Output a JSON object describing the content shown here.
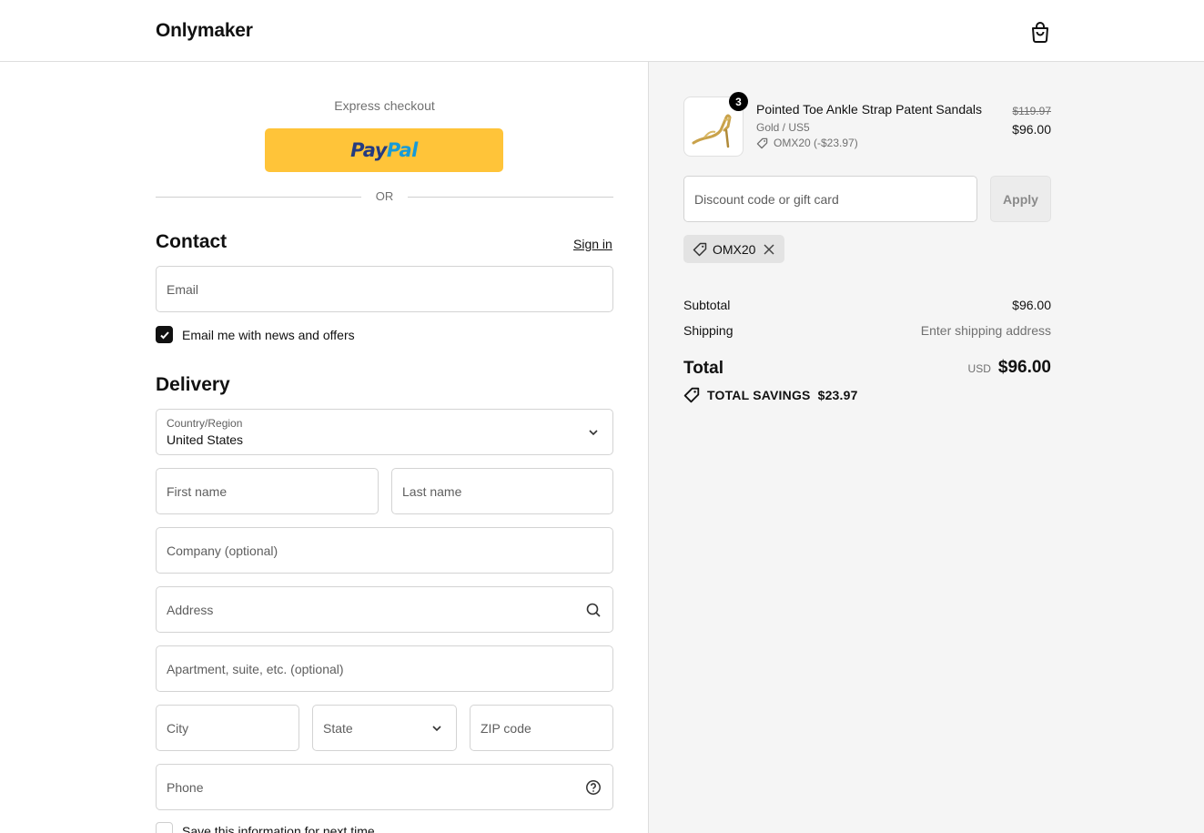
{
  "header": {
    "brand": "Onlymaker",
    "cart_icon": "shopping-bag-icon"
  },
  "express": {
    "label": "Express checkout",
    "paypal_pay": "Pay",
    "paypal_pal": "Pal",
    "or": "OR"
  },
  "contact": {
    "title": "Contact",
    "signin": "Sign in",
    "email_placeholder": "Email",
    "newsletter_label": "Email me with news and offers",
    "newsletter_checked": true
  },
  "delivery": {
    "title": "Delivery",
    "country_label": "Country/Region",
    "country_value": "United States",
    "first_name": "First name",
    "last_name": "Last name",
    "company": "Company (optional)",
    "address": "Address",
    "apartment": "Apartment, suite, etc. (optional)",
    "city": "City",
    "state": "State",
    "zip": "ZIP code",
    "phone": "Phone",
    "save_info_label": "Save this information for next time"
  },
  "summary": {
    "item": {
      "quantity": "3",
      "name": "Pointed Toe Ankle Strap Patent Sandals",
      "variant": "Gold / US5",
      "discount": "OMX20 (-$23.97)",
      "original_price": "$119.97",
      "price": "$96.00"
    },
    "discount_placeholder": "Discount code or gift card",
    "apply_label": "Apply",
    "applied_code": "OMX20",
    "subtotal_label": "Subtotal",
    "subtotal_value": "$96.00",
    "shipping_label": "Shipping",
    "shipping_value": "Enter shipping address",
    "total_label": "Total",
    "currency": "USD",
    "total_value": "$96.00",
    "savings_label": "TOTAL SAVINGS",
    "savings_value": "$23.97"
  },
  "colors": {
    "paypal_yellow": "#ffc439",
    "paypal_blue_dark": "#253b80",
    "paypal_blue_light": "#179bd7",
    "summary_bg": "#f5f5f5"
  }
}
